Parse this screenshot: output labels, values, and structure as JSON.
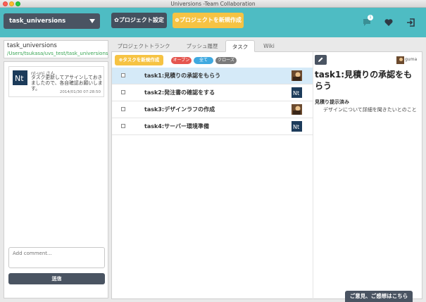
{
  "window": {
    "title": "Universions -Team Collaboration"
  },
  "header": {
    "project_selected": "task_universions",
    "settings_label": "プロジェクト設定",
    "new_project_label": "プロジェクトを新規作成",
    "notification_count": "1"
  },
  "left": {
    "project_name": "task_universions",
    "project_path": "/Users/tsukasa/uvs_test/task_universions",
    "messages": [
      {
        "author": "nt-uni さん",
        "body": "タスク更新してアサインしておきましたので、各自確認お願いします。",
        "time": "2014/01/30 07:28:50"
      }
    ],
    "comment_placeholder": "Add comment...",
    "send_label": "送信"
  },
  "tabs": [
    {
      "label": "プロジェクトトランク"
    },
    {
      "label": "プッシュ履歴"
    },
    {
      "label": "タスク"
    },
    {
      "label": "Wiki"
    }
  ],
  "tasks": {
    "new_task_label": "タスクを新規作成",
    "filters": {
      "open": "オープン",
      "all": "全て",
      "close": "クローズ"
    },
    "items": [
      {
        "name": "task1:見積りの承認をもらう"
      },
      {
        "name": "task2:発注書の確認をする"
      },
      {
        "name": "task3:デザインラフの作成"
      },
      {
        "name": "task4:サーバー環境準備"
      }
    ]
  },
  "detail": {
    "owner": "guma",
    "title": "task1:見積りの承認をもらう",
    "status": "見積り提示済み",
    "description": "デザインについて詳細を聞きたいとのこと"
  },
  "feedback_label": "ご意見、ご感想はこちら",
  "colors": {
    "header": "#4ebcc3",
    "dark": "#4a5462",
    "accent": "#f6c343",
    "selected_row": "#d5eaf8"
  }
}
